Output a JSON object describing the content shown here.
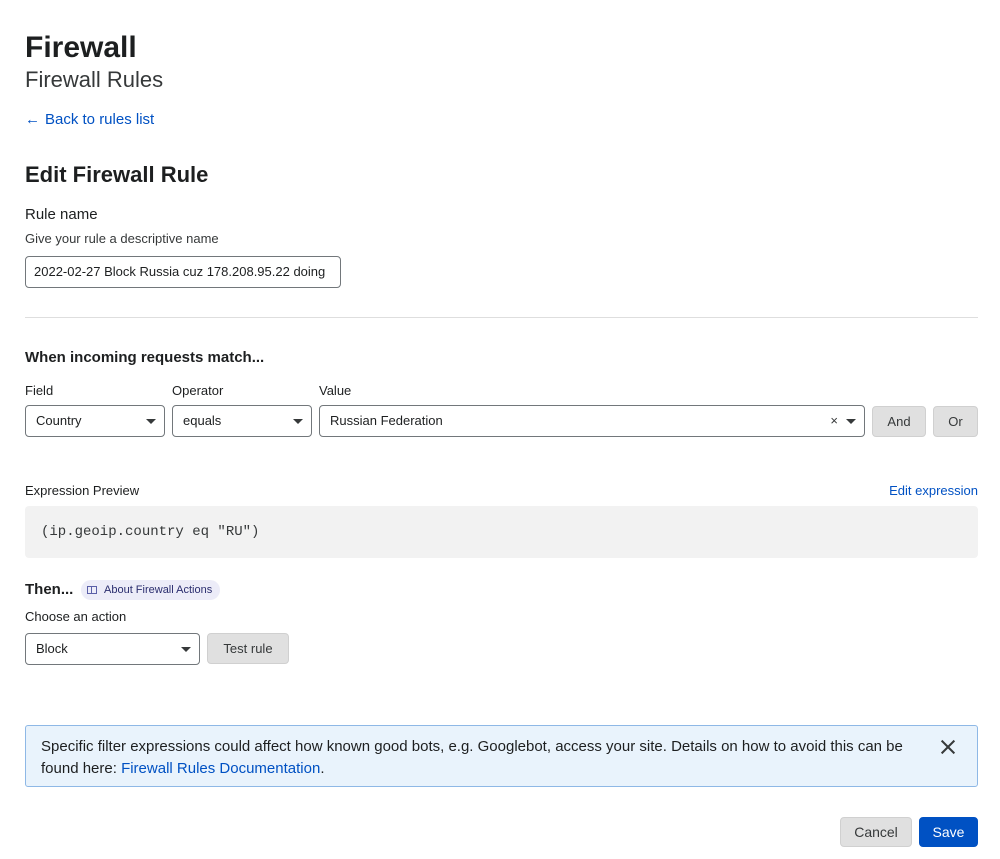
{
  "header": {
    "title": "Firewall",
    "subtitle": "Firewall Rules",
    "back_arrow": "←",
    "back_link": "Back to rules list"
  },
  "form": {
    "section_title": "Edit Firewall Rule",
    "rule_name_label": "Rule name",
    "rule_name_hint": "Give your rule a descriptive name",
    "rule_name_value": "2022-02-27 Block Russia cuz 178.208.95.22 doing"
  },
  "match": {
    "title": "When incoming requests match...",
    "field_label": "Field",
    "operator_label": "Operator",
    "value_label": "Value",
    "field_value": "Country",
    "operator_value": "equals",
    "value_value": "Russian Federation",
    "clear_glyph": "×",
    "and_label": "And",
    "or_label": "Or"
  },
  "expression": {
    "label": "Expression Preview",
    "edit_link": "Edit expression",
    "code": "(ip.geoip.country eq \"RU\")"
  },
  "action": {
    "then_label": "Then...",
    "about_badge": "About Firewall Actions",
    "choose_label": "Choose an action",
    "selected": "Block",
    "test_label": "Test rule"
  },
  "notice": {
    "text": "Specific filter expressions could affect how known good bots, e.g. Googlebot, access your site. Details on how to avoid this can be found here: ",
    "link": "Firewall Rules Documentation",
    "trailing": "."
  },
  "footer": {
    "cancel_label": "Cancel",
    "save_label": "Save"
  },
  "colors": {
    "link": "#0051c3",
    "primary": "#0051c3",
    "notice_bg": "#e9f3fc",
    "notice_border": "#8eb8e6"
  }
}
